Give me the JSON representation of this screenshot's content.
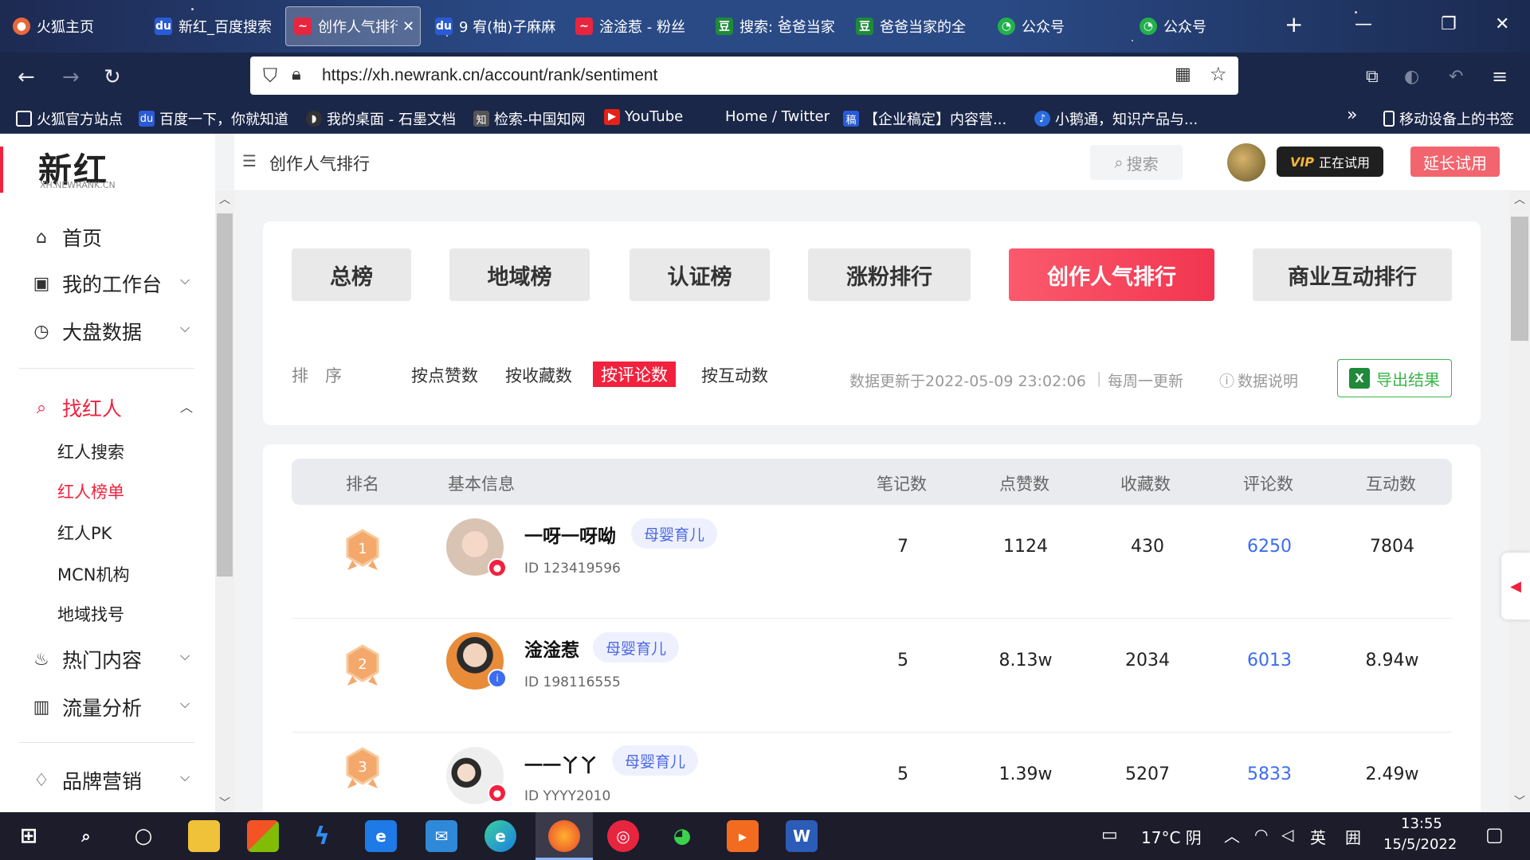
{
  "browser": {
    "tabs": [
      {
        "label": "火狐主页",
        "icon": "firefox-icon",
        "color": "#e8683a"
      },
      {
        "label": "新红_百度搜索",
        "icon": "baidu-paw-icon",
        "color": "#2a5bd7"
      },
      {
        "label": "创作人气排行",
        "icon": "newrank-icon",
        "color": "#e8253f",
        "active": true
      },
      {
        "label": "9 宥(柚)子麻麻",
        "icon": "baidu-paw-icon",
        "color": "#2a5bd7"
      },
      {
        "label": "淦淦惹 - 粉丝",
        "icon": "newrank-icon",
        "color": "#e8253f"
      },
      {
        "label": "搜索: 爸爸当家",
        "icon": "douban-icon",
        "color": "#1e8a3a",
        "glyph": "豆"
      },
      {
        "label": "爸爸当家的全",
        "icon": "douban-icon",
        "color": "#1e8a3a",
        "glyph": "豆"
      },
      {
        "label": "公众号",
        "icon": "wechat-icon",
        "color": "#22b14c"
      },
      {
        "label": "公众号",
        "icon": "wechat-icon",
        "color": "#22b14c"
      }
    ],
    "new_tab": "+",
    "url": "https://xh.newrank.cn/account/rank/sentiment",
    "bookmarks": [
      {
        "label": "火狐官方站点",
        "icon": "folder-icon"
      },
      {
        "label": "百度一下，你就知道",
        "icon": "baidu-paw-icon"
      },
      {
        "label": "我的桌面 - 石墨文档",
        "icon": "shimo-icon"
      },
      {
        "label": "检索-中国知网",
        "icon": "cnki-icon"
      },
      {
        "label": "YouTube",
        "icon": "youtube-icon"
      },
      {
        "label": "Home / Twitter",
        "icon": "twitter-icon"
      },
      {
        "label": "【企业稿定】内容营...",
        "icon": "gaoding-icon",
        "glyph": "稿"
      },
      {
        "label": "小鹅通，知识产品与...",
        "icon": "xiaoetong-icon"
      }
    ],
    "more_bookmarks": "»",
    "mobile_bookmarks": "移动设备上的书签"
  },
  "app": {
    "logo": "新红",
    "logo_sub": "XH.NEWRANK.CN",
    "page_title": "创作人气排行",
    "search_placeholder": "搜索",
    "vip_badge": "VIP",
    "vip_status": "正在试用",
    "extend_button": "延长试用"
  },
  "sidebar": {
    "items": [
      {
        "label": "首页",
        "icon": "home-icon"
      },
      {
        "label": "我的工作台",
        "icon": "workbench-icon",
        "chevron": "down"
      },
      {
        "label": "大盘数据",
        "icon": "dashboard-icon",
        "chevron": "down"
      },
      {
        "label": "找红人",
        "icon": "search-icon",
        "chevron": "up",
        "active": true
      },
      {
        "label": "热门内容",
        "icon": "fire-icon",
        "chevron": "down"
      },
      {
        "label": "流量分析",
        "icon": "chart-icon",
        "chevron": "down"
      },
      {
        "label": "品牌营销",
        "icon": "diamond-icon",
        "chevron": "down"
      }
    ],
    "subitems": [
      "红人搜索",
      "红人榜单",
      "红人PK",
      "MCN机构",
      "地域找号"
    ],
    "active_sub": 1
  },
  "rank_tabs": [
    "总榜",
    "地域榜",
    "认证榜",
    "涨粉排行",
    "创作人气排行",
    "商业互动排行"
  ],
  "active_rank_tab": 4,
  "sort": {
    "label": "排　序",
    "options": [
      "按点赞数",
      "按收藏数",
      "按评论数",
      "按互动数"
    ],
    "active": 2
  },
  "update_info": "数据更新于2022-05-09 23:02:06",
  "update_freq": "每周一更新",
  "data_note": "数据说明",
  "export_button": "导出结果",
  "table": {
    "headers": [
      "排名",
      "基本信息",
      "笔记数",
      "点赞数",
      "收藏数",
      "评论数",
      "互动数"
    ],
    "rows": [
      {
        "rank": "1",
        "name": "一呀一呀呦",
        "tag": "母婴育儿",
        "id": "ID 123419596",
        "notes": "7",
        "likes": "1124",
        "favs": "430",
        "comments": "6250",
        "interactions": "7804",
        "verify": "red"
      },
      {
        "rank": "2",
        "name": "淦淦惹",
        "tag": "母婴育儿",
        "id": "ID 198116555",
        "notes": "5",
        "likes": "8.13w",
        "favs": "2034",
        "comments": "6013",
        "interactions": "8.94w",
        "verify": "blue"
      },
      {
        "rank": "3",
        "name": "一一丫丫",
        "tag": "母婴育儿",
        "id": "ID YYYY2010",
        "notes": "5",
        "likes": "1.39w",
        "favs": "5207",
        "comments": "5833",
        "interactions": "2.49w",
        "verify": "red"
      }
    ]
  },
  "taskbar": {
    "weather": "17°C 阴",
    "ime": "英",
    "time": "13:55",
    "date": "15/5/2022"
  },
  "colors": {
    "brand_red": "#f2213d",
    "link_blue": "#3c6cf0",
    "export_green": "#3bb54a"
  }
}
